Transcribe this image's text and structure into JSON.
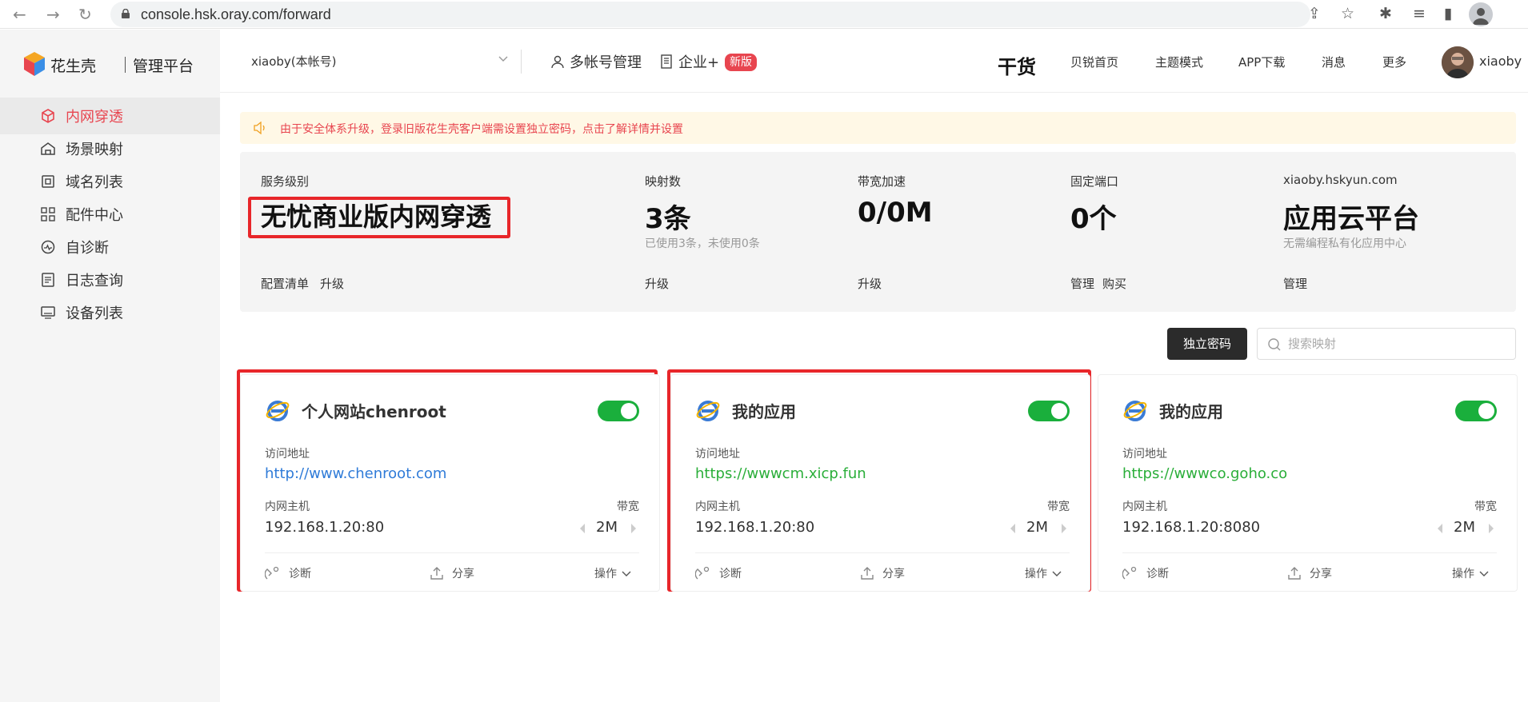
{
  "browser": {
    "url": "console.hsk.oray.com/forward"
  },
  "sidebar": {
    "logo_name": "花生壳",
    "logo_sub": "管理平台",
    "items": [
      {
        "label": "内网穿透",
        "icon": "cube-icon",
        "active": true
      },
      {
        "label": "场景映射",
        "icon": "house-icon"
      },
      {
        "label": "域名列表",
        "icon": "domain-icon"
      },
      {
        "label": "配件中心",
        "icon": "grid-icon"
      },
      {
        "label": "自诊断",
        "icon": "diagnose-icon"
      },
      {
        "label": "日志查询",
        "icon": "log-icon"
      },
      {
        "label": "设备列表",
        "icon": "monitor-icon"
      }
    ]
  },
  "header": {
    "account": "xiaoby(本帐号)",
    "multi_account": "多帐号管理",
    "enterprise": "企业+",
    "new_badge": "新版",
    "brand_mark": "干货",
    "nav": [
      "贝锐首页",
      "主题模式",
      "APP下载",
      "消息",
      "更多"
    ],
    "username": "xiaoby"
  },
  "notice": {
    "text": "由于安全体系升级，登录旧版花生壳客户端需设置独立密码，点击了解详情并设置"
  },
  "stats": [
    {
      "label": "服务级别",
      "value": "无忧商业版内网穿透",
      "sub": "",
      "links": [
        "配置清单",
        "升级"
      ]
    },
    {
      "label": "映射数",
      "value": "3条",
      "sub": "已使用3条，未使用0条",
      "links": [
        "升级"
      ]
    },
    {
      "label": "带宽加速",
      "value": "0/0M",
      "sub": "",
      "links": [
        "升级"
      ]
    },
    {
      "label": "固定端口",
      "value": "0个",
      "sub": "",
      "links": [
        "管理",
        "购买"
      ]
    },
    {
      "label": "xiaoby.hskyun.com",
      "value": "应用云平台",
      "sub": "无需编程私有化应用中心",
      "links": [
        "管理"
      ]
    }
  ],
  "toolbar": {
    "password_button": "独立密码",
    "search_placeholder": "搜索映射"
  },
  "cards": [
    {
      "title": "个人网站chenroot",
      "url_label": "访问地址",
      "url": "http://www.chenroot.com",
      "url_color": "#2f7bd8",
      "host_label": "内网主机",
      "host": "192.168.1.20:80",
      "bw_label": "带宽",
      "bw": "2M",
      "diagnose": "诊断",
      "share": "分享",
      "ops": "操作",
      "enabled": true
    },
    {
      "title": "我的应用",
      "url_label": "访问地址",
      "url": "https://wwwcm.xicp.fun",
      "url_color": "#2aae39",
      "host_label": "内网主机",
      "host": "192.168.1.20:80",
      "bw_label": "带宽",
      "bw": "2M",
      "diagnose": "诊断",
      "share": "分享",
      "ops": "操作",
      "enabled": true
    },
    {
      "title": "我的应用",
      "url_label": "访问地址",
      "url": "https://wwwco.goho.co",
      "url_color": "#2aae39",
      "host_label": "内网主机",
      "host": "192.168.1.20:8080",
      "bw_label": "带宽",
      "bw": "2M",
      "diagnose": "诊断",
      "share": "分享",
      "ops": "操作",
      "enabled": true
    }
  ],
  "colors": {
    "accent": "#e8454f",
    "toggle_on": "#1aaf3c",
    "highlight_box": "#e8262a"
  }
}
